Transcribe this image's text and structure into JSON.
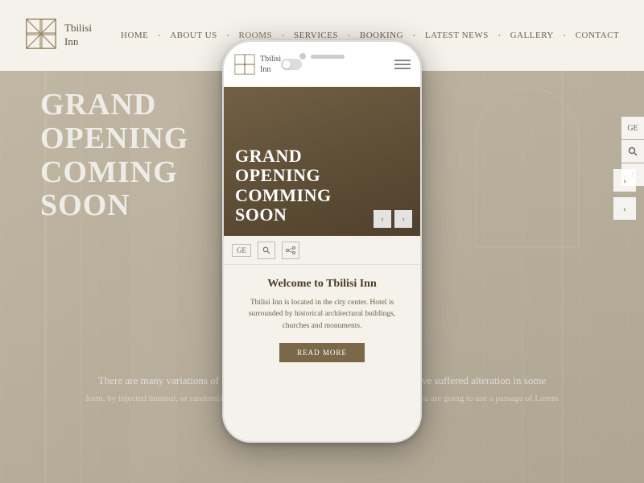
{
  "header": {
    "logo_name": "Tbilisi",
    "logo_name2": "Inn",
    "nav": [
      {
        "label": "HOME",
        "active": false
      },
      {
        "label": "ABOUT US",
        "active": false
      },
      {
        "label": "ROOMS",
        "active": true
      },
      {
        "label": "SERVICES",
        "active": false
      },
      {
        "label": "BOOKING",
        "active": false
      },
      {
        "label": "LATEST NEWS",
        "active": false
      },
      {
        "label": "GALLERY",
        "active": false
      },
      {
        "label": "CONTACT",
        "active": false
      }
    ]
  },
  "hero": {
    "line1": "GRAND",
    "line2": "OPENING",
    "line3": "COMING",
    "line4": "SOON"
  },
  "mobile": {
    "hero": {
      "line1": "GRAND",
      "line2": "OPENING",
      "line3": "COMMING",
      "line4": "SOON"
    },
    "welcome_title": "Welcome to Tbilisi Inn",
    "welcome_text": "Tbilisi Inn is located in the city center. Hotel is surrounded by historical architectural buildings, churches and monuments.",
    "read_more": "READ MORE",
    "toolbar_lang": "GE",
    "arrow_left": "‹",
    "arrow_right": "›"
  },
  "sidebar": {
    "lang": "GE",
    "search": "🔍",
    "social": "f"
  },
  "arrows": {
    "next": "›",
    "prev": "‹"
  }
}
